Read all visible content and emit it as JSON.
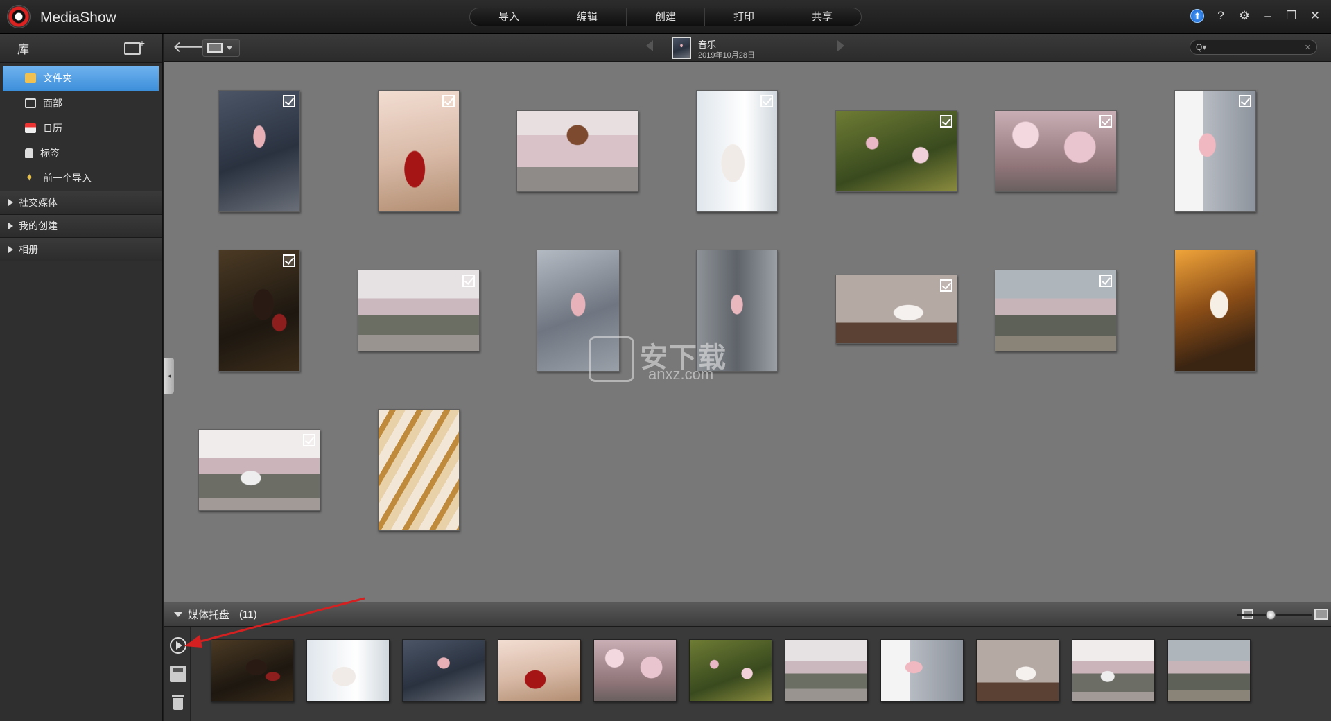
{
  "app": {
    "title": "MediaShow"
  },
  "nav": [
    "导入",
    "编辑",
    "创建",
    "打印",
    "共享"
  ],
  "window_controls": {
    "update": "⬆",
    "help": "?",
    "settings": "⚙",
    "minimize": "–",
    "restore": "❐",
    "close": "✕"
  },
  "sidebar": {
    "title": "库",
    "items": [
      {
        "label": "文件夹",
        "icon": "folder-icon",
        "selected": true
      },
      {
        "label": "面部",
        "icon": "face-icon"
      },
      {
        "label": "日历",
        "icon": "calendar-icon"
      },
      {
        "label": "标签",
        "icon": "tag-icon"
      },
      {
        "label": "前一个导入",
        "icon": "star-icon"
      }
    ],
    "sections": [
      "社交媒体",
      "我的创建",
      "相册"
    ]
  },
  "toolbar": {
    "album_name": "音乐",
    "album_date": "2019年10月28日",
    "search_placeholder": "",
    "search_icon": "Q▾",
    "clear_icon": "✕"
  },
  "watermark": {
    "big": "安下载",
    "small": "anxz.com"
  },
  "tray": {
    "title": "媒体托盘",
    "count": "(11)",
    "zoom_level": 0.45
  },
  "colors": {
    "accent": "#4a96dc",
    "content_bg": "#787878",
    "arrow": "#d42020"
  }
}
